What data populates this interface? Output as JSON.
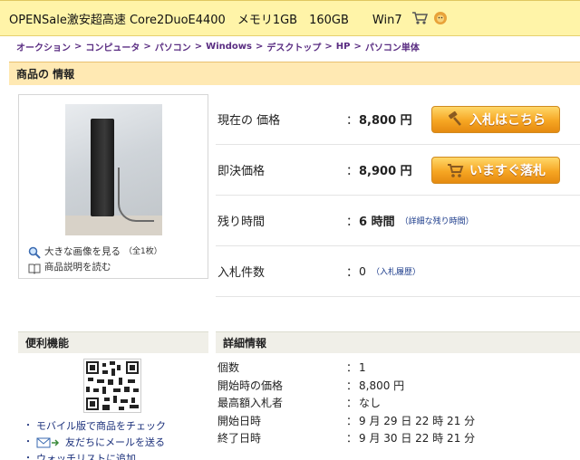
{
  "title": {
    "text": "OPENSale激安超高速 Core2DuoE4400　メモリ1GB　160GB　　Win7",
    "icons": [
      "cart-icon",
      "lion-icon"
    ]
  },
  "breadcrumb": [
    "オークション",
    "コンピュータ",
    "パソコン",
    "Windows",
    "デスクトップ",
    "HP",
    "パソコン単体"
  ],
  "breadcrumb_sep": ">",
  "section": {
    "title": "商品の 情報"
  },
  "image_panel": {
    "view_large": "大きな画像を見る",
    "image_count": "（全1枚）",
    "read_desc": "商品説明を読む"
  },
  "info": {
    "rows": [
      {
        "label": "現在の 価格",
        "colon": "：",
        "value": "8,800 円"
      },
      {
        "label": "即決価格",
        "colon": "：",
        "value": "8,900 円"
      },
      {
        "label": "残り時間",
        "colon": "：",
        "value": "6 時間",
        "link": "（詳細な残り時間）"
      },
      {
        "label": "入札件数",
        "colon": "：",
        "value": "0",
        "link": "（入札履歴）"
      }
    ],
    "bid_button": "入札はこちら",
    "buy_button": "いますぐ落札"
  },
  "sidebar": {
    "title": "便利機能",
    "links": [
      "モバイル版で商品をチェック",
      "友だちにメールを送る",
      "ウォッチリストに追加"
    ]
  },
  "details": {
    "title": "詳細情報",
    "rows": [
      {
        "label": "個数",
        "colon": "：",
        "value": "1"
      },
      {
        "label": "開始時の価格",
        "colon": "：",
        "value": "8,800 円"
      },
      {
        "label": "最高額入札者",
        "colon": "：",
        "value": "なし"
      },
      {
        "label": "開始日時",
        "colon": "：",
        "value": "9 月 29 日 22 時 21 分"
      },
      {
        "label": "終了日時",
        "colon": "：",
        "value": "9 月 30 日 22 時 21 分"
      }
    ]
  },
  "colors": {
    "accent": "#f6a623",
    "link": "#5a2d82",
    "title_bg": "#fff4a8",
    "section_bg": "#ffe9b3"
  }
}
